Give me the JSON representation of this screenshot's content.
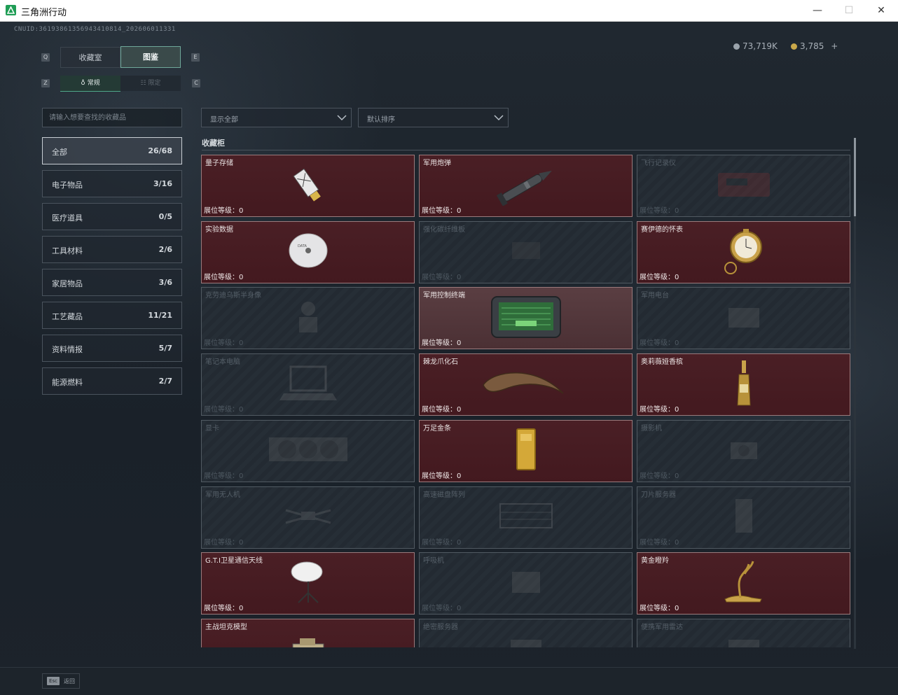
{
  "window": {
    "title": "三角洲行动",
    "minimize": "—",
    "maximize": "☐",
    "close": "✕"
  },
  "header": {
    "uid": "CNUID:36193861356943410814_202606011331",
    "silver": "73,719K",
    "gold": "3,785",
    "gold_add": "+"
  },
  "tabs": {
    "prev_key": "Q",
    "next_key": "E",
    "items": [
      "收藏室",
      "图鉴"
    ],
    "active": "图鉴"
  },
  "subtabs": {
    "prev_key": "Z",
    "next_key": "C",
    "items": [
      "常规",
      "限定"
    ],
    "active": "常规"
  },
  "search": {
    "placeholder": "请输入想要查找的收藏品"
  },
  "categories": [
    {
      "label": "全部",
      "count": "26/68",
      "active": true
    },
    {
      "label": "电子物品",
      "count": "3/16"
    },
    {
      "label": "医疗道具",
      "count": "0/5"
    },
    {
      "label": "工具材料",
      "count": "2/6"
    },
    {
      "label": "家居物品",
      "count": "3/6"
    },
    {
      "label": "工艺藏品",
      "count": "11/21"
    },
    {
      "label": "资料情报",
      "count": "5/7"
    },
    {
      "label": "能源燃料",
      "count": "2/7"
    }
  ],
  "filters": {
    "show": "显示全部",
    "sort": "默认排序"
  },
  "section_title": "收藏柜",
  "level_label": "展位等级：",
  "items": [
    {
      "name": "量子存储",
      "level": "0",
      "owned": true,
      "icon": "usb-drive-icon"
    },
    {
      "name": "军用炮弹",
      "level": "0",
      "owned": true,
      "icon": "artillery-shell-icon"
    },
    {
      "name": "飞行记录仪",
      "level": "0",
      "owned": false,
      "icon": "flight-recorder-icon"
    },
    {
      "name": "实验数据",
      "level": "0",
      "owned": true,
      "icon": "disc-icon"
    },
    {
      "name": "强化碳纤维板",
      "level": "0",
      "owned": false,
      "icon": "carbon-plate-icon"
    },
    {
      "name": "赛伊德的怀表",
      "level": "0",
      "owned": true,
      "icon": "pocket-watch-icon"
    },
    {
      "name": "克劳迪乌斯半身像",
      "level": "0",
      "owned": false,
      "icon": "bust-icon"
    },
    {
      "name": "军用控制终端",
      "level": "0",
      "owned": true,
      "highlight": true,
      "icon": "control-terminal-icon"
    },
    {
      "name": "军用电台",
      "level": "0",
      "owned": false,
      "icon": "radio-icon"
    },
    {
      "name": "笔记本电脑",
      "level": "0",
      "owned": false,
      "icon": "laptop-icon"
    },
    {
      "name": "棘龙爪化石",
      "level": "0",
      "owned": true,
      "icon": "claw-fossil-icon"
    },
    {
      "name": "奥莉薇娅香槟",
      "level": "0",
      "owned": true,
      "icon": "champagne-icon"
    },
    {
      "name": "显卡",
      "level": "0",
      "owned": false,
      "icon": "graphics-card-icon"
    },
    {
      "name": "万足金条",
      "level": "0",
      "owned": true,
      "icon": "gold-bar-icon"
    },
    {
      "name": "摄影机",
      "level": "0",
      "owned": false,
      "icon": "camera-icon"
    },
    {
      "name": "军用无人机",
      "level": "0",
      "owned": false,
      "icon": "drone-icon"
    },
    {
      "name": "高速磁盘阵列",
      "level": "0",
      "owned": false,
      "icon": "disk-array-icon"
    },
    {
      "name": "刀片服务器",
      "level": "0",
      "owned": false,
      "icon": "blade-server-icon"
    },
    {
      "name": "G.T.I卫星通信天线",
      "level": "0",
      "owned": true,
      "icon": "satellite-dish-icon"
    },
    {
      "name": "呼吸机",
      "level": "0",
      "owned": false,
      "icon": "ventilator-icon"
    },
    {
      "name": "黄金瞪羚",
      "level": "0",
      "owned": true,
      "icon": "gold-gazelle-icon"
    },
    {
      "name": "主战坦克模型",
      "level": "",
      "owned": true,
      "icon": "tank-model-icon"
    },
    {
      "name": "绝密服务器",
      "level": "",
      "owned": false,
      "icon": "server-icon"
    },
    {
      "name": "便携军用雷达",
      "level": "",
      "owned": false,
      "icon": "radar-icon"
    }
  ],
  "footer": {
    "esc_key": "Esc",
    "esc_label": "返回"
  }
}
